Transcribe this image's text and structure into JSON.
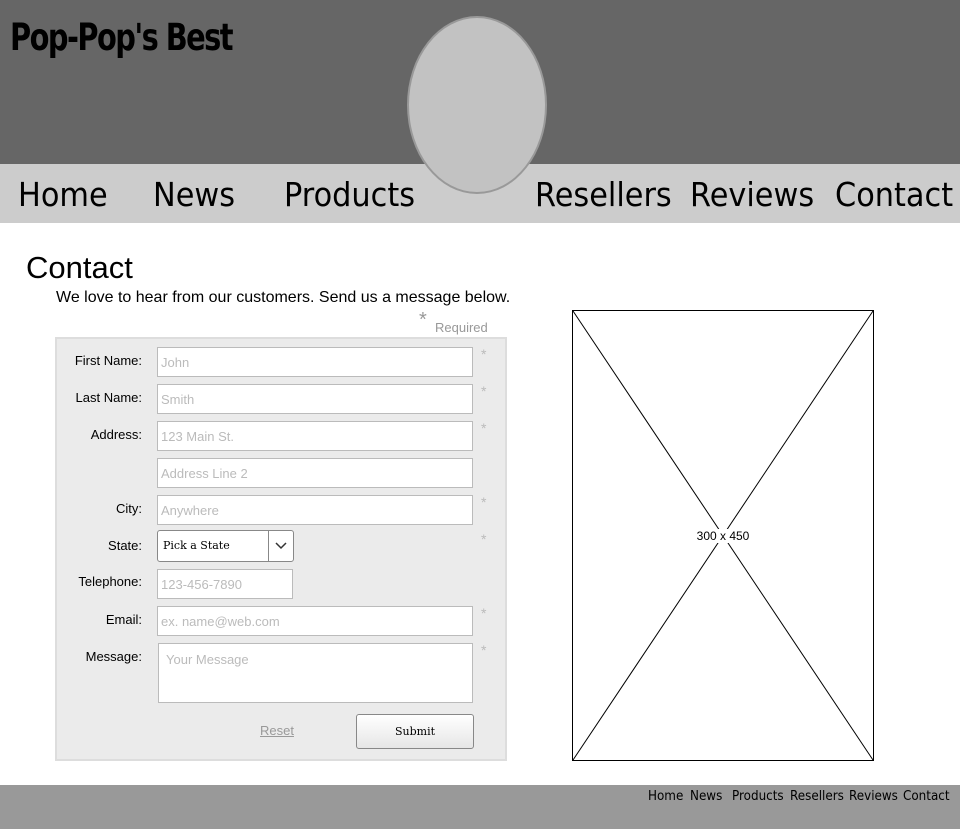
{
  "header": {
    "logo_text": "Pop-Pop's Best"
  },
  "nav": {
    "items": [
      {
        "label": "Home"
      },
      {
        "label": "News"
      },
      {
        "label": "Products"
      },
      {
        "label": "Resellers"
      },
      {
        "label": "Reviews"
      },
      {
        "label": "Contact"
      }
    ]
  },
  "main": {
    "title": "Contact",
    "intro": "We love to hear from our customers. Send us a message below.",
    "required_star": "*",
    "required_label": "Required"
  },
  "form": {
    "fields": {
      "first_name": {
        "label": "First Name:",
        "value": "",
        "placeholder": "John",
        "required": true
      },
      "last_name": {
        "label": "Last Name:",
        "value": "",
        "placeholder": "Smith",
        "required": true
      },
      "address": {
        "label": "Address:",
        "value": "",
        "placeholder": "123 Main St.",
        "required": true
      },
      "address2": {
        "label": "",
        "value": "",
        "placeholder": "Address Line 2",
        "required": false
      },
      "city": {
        "label": "City:",
        "value": "",
        "placeholder": "Anywhere",
        "required": true
      },
      "state": {
        "label": "State:",
        "selected": "Pick a State",
        "required": true
      },
      "telephone": {
        "label": "Telephone:",
        "value": "",
        "placeholder": "123-456-7890",
        "required": false
      },
      "email": {
        "label": "Email:",
        "value": "",
        "placeholder": "ex. name@web.com",
        "required": true
      },
      "message": {
        "label": "Message:",
        "value": "",
        "placeholder": "Your Message",
        "required": true
      }
    },
    "star": "*",
    "reset_label": "Reset",
    "submit_label": "Submit"
  },
  "image_placeholder": {
    "label": "300 x 450"
  },
  "footer": {
    "links": [
      {
        "label": "Home"
      },
      {
        "label": "News"
      },
      {
        "label": "Products"
      },
      {
        "label": "Resellers"
      },
      {
        "label": "Reviews"
      },
      {
        "label": "Contact"
      }
    ]
  },
  "colors": {
    "header_bg": "#666666",
    "nav_bg": "#cccccc",
    "footer_bg": "#999999",
    "form_bg": "#ebebeb",
    "oval_fill": "#c2c2c2"
  },
  "icons": {
    "select_arrow": "chevron-down-icon"
  }
}
